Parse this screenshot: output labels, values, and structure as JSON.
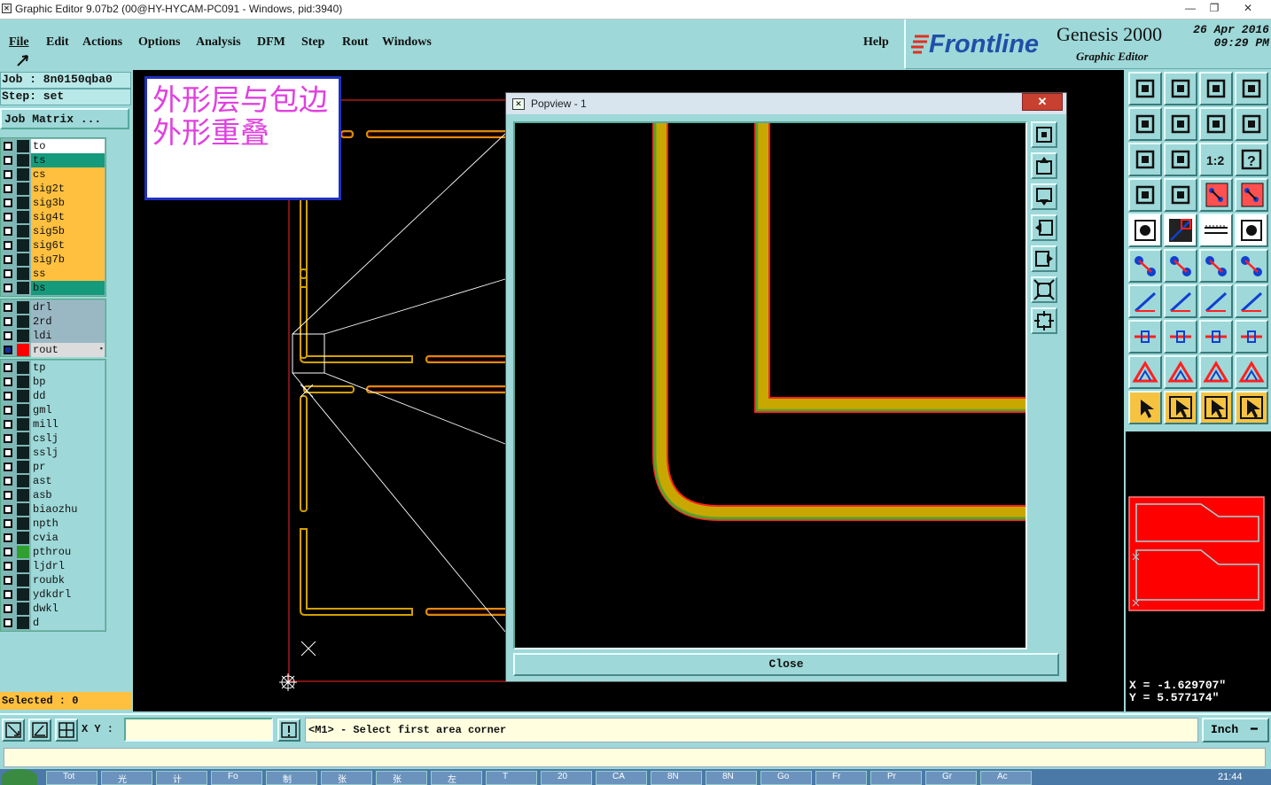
{
  "window": {
    "title": "Graphic Editor 9.07b2 (00@HY-HYCAM-PC091 - Windows, pid:3940)",
    "minimize": "—",
    "maximize": "❐",
    "close": "✕"
  },
  "menu": {
    "items": [
      "File",
      "Edit",
      "Actions",
      "Options",
      "Analysis",
      "DFM",
      "Step",
      "Rout",
      "Windows"
    ],
    "help": "Help"
  },
  "brand": {
    "logo": "Frontline",
    "product": "Genesis 2000",
    "subtitle": "Graphic Editor",
    "date": "26 Apr 2016",
    "time": "09:29 PM"
  },
  "job": {
    "job_line": "Job : 8n0150qba0",
    "step_line": "Step: set",
    "matrix_button": "Job Matrix ..."
  },
  "layer_groups": [
    [
      {
        "name": "to",
        "color": "#ffffff"
      },
      {
        "name": "ts",
        "color": "#159a7c"
      },
      {
        "name": "cs",
        "color": "#ffc03f"
      },
      {
        "name": "sig2t",
        "color": "#ffc03f"
      },
      {
        "name": "sig3b",
        "color": "#ffc03f"
      },
      {
        "name": "sig4t",
        "color": "#ffc03f"
      },
      {
        "name": "sig5b",
        "color": "#ffc03f"
      },
      {
        "name": "sig6t",
        "color": "#ffc03f"
      },
      {
        "name": "sig7b",
        "color": "#ffc03f"
      },
      {
        "name": "ss",
        "color": "#ffc03f"
      },
      {
        "name": "bs",
        "color": "#159a7c"
      }
    ],
    [
      {
        "name": "drl",
        "color": "#9ab8c4"
      },
      {
        "name": "2rd",
        "color": "#9ab8c4"
      },
      {
        "name": "ldi",
        "color": "#9ab8c4"
      },
      {
        "name": "rout",
        "color": "#dcdcdc",
        "active": true,
        "swatch": "#ff0000"
      }
    ],
    [
      {
        "name": "tp",
        "color": "#9ed8d8"
      },
      {
        "name": "bp",
        "color": "#9ed8d8"
      },
      {
        "name": "dd",
        "color": "#9ed8d8"
      },
      {
        "name": "gml",
        "color": "#9ed8d8"
      },
      {
        "name": "mill",
        "color": "#9ed8d8"
      },
      {
        "name": "cslj",
        "color": "#9ed8d8"
      },
      {
        "name": "sslj",
        "color": "#9ed8d8"
      },
      {
        "name": "pr",
        "color": "#9ed8d8"
      },
      {
        "name": "ast",
        "color": "#9ed8d8"
      },
      {
        "name": "asb",
        "color": "#9ed8d8"
      },
      {
        "name": "biaozhu",
        "color": "#9ed8d8"
      },
      {
        "name": "npth",
        "color": "#9ed8d8"
      },
      {
        "name": "cvia",
        "color": "#9ed8d8"
      },
      {
        "name": "pthrou",
        "color": "#9ed8d8",
        "swatch": "#2fa02f"
      },
      {
        "name": "ljdrl",
        "color": "#9ed8d8"
      },
      {
        "name": "roubk",
        "color": "#9ed8d8"
      },
      {
        "name": "ydkdrl",
        "color": "#9ed8d8"
      },
      {
        "name": "dwkl",
        "color": "#9ed8d8"
      },
      {
        "name": "d",
        "color": "#9ed8d8"
      }
    ]
  ],
  "selected_text": "Selected : 0",
  "annotation": {
    "line1": "外形层与包边",
    "line2": "外形重叠"
  },
  "popview": {
    "title": "Popview - 1",
    "close_label": "Close",
    "close_x": "✕"
  },
  "coords": {
    "x": "X = -1.629707\"",
    "y": "Y = 5.577174\""
  },
  "bottom": {
    "xy_label": "X Y :",
    "xy_value": "",
    "message": "<M1> - Select first area corner",
    "unit": "Inch"
  },
  "taskbar": {
    "items": [
      "Tot",
      "光",
      "计",
      "Fo",
      "制",
      "张",
      "张",
      "左",
      "T",
      "20",
      "CA",
      "8N",
      "8N",
      "Go",
      "Fr",
      "Pr",
      "Gr",
      "Ac"
    ],
    "clock": "21:44"
  },
  "colors": {
    "panel": "#9ed8d8",
    "accent_red": "#ff0000",
    "trace_yellow": "#c8a800",
    "outline_red": "#ff2020",
    "signal_layer": "#ffc03f",
    "board_layer": "#159a7c"
  },
  "icons": {
    "right_toolbar": [
      "zoom-home-icon",
      "zoom-down-icon",
      "home-icon",
      "grid-icon",
      "zoom-left-icon",
      "zoom-right-icon",
      "one-to-one-icon",
      "snap-icon",
      "fit-screen-icon",
      "zoom-center-icon",
      "scale-icon",
      "help-icon",
      "measure-icon",
      "feature-icon",
      "net-icon",
      "layer-icon",
      "pad-icon",
      "resize-icon",
      "ruler-icon",
      "circle-icon",
      "connect-icon",
      "cross-icon",
      "node-icon",
      "link-icon",
      "line-icon",
      "slash-icon",
      "arc-icon",
      "flip-icon",
      "dot-icon",
      "split-icon",
      "box-icon",
      "cluster-icon",
      "polygon-icon",
      "triangle-icon",
      "arch-icon",
      "mountain-icon",
      "select-icon",
      "select-box-icon",
      "select-area-icon",
      "path-select-icon"
    ]
  }
}
